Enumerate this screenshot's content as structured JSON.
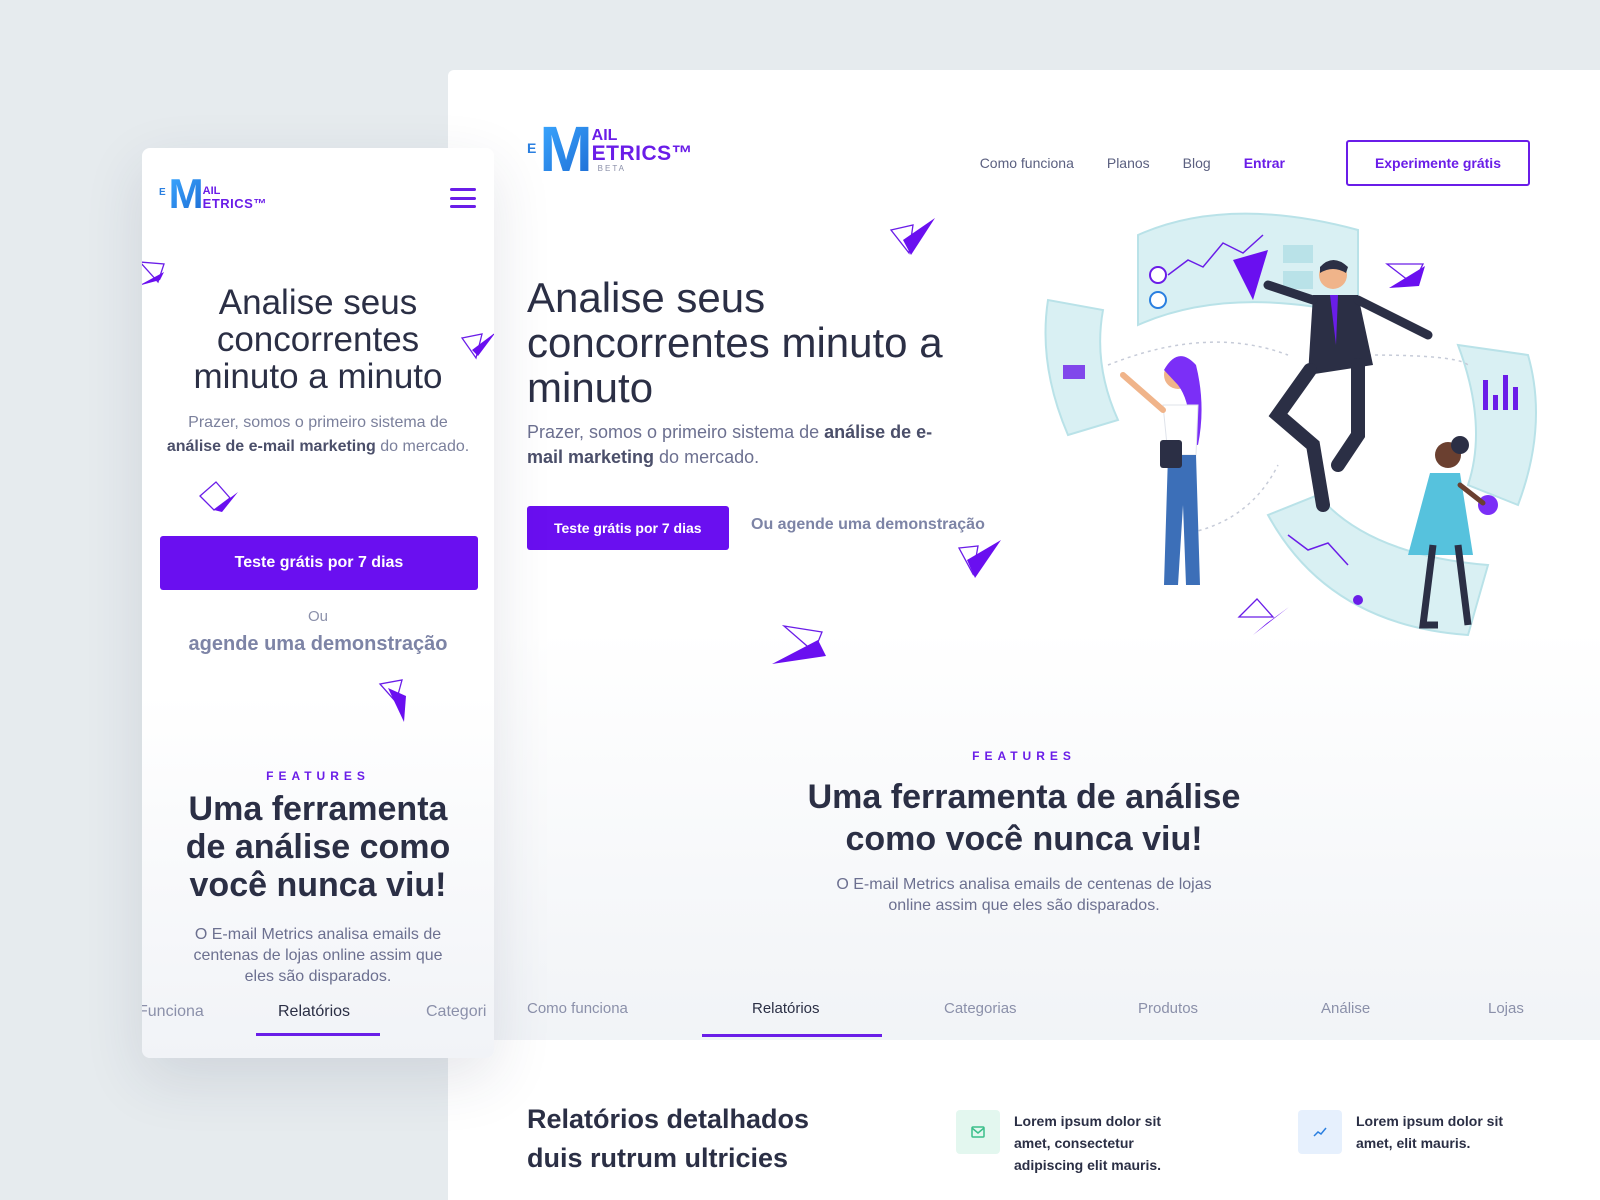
{
  "brand": {
    "logo_e": "E",
    "logo_m": "M",
    "logo_ail": "AIL",
    "logo_etrics": "ETRICS™",
    "logo_beta": "BETA",
    "accent_color": "#6a1de8",
    "logo_color": "#1f8ce8"
  },
  "desktop": {
    "nav": {
      "items": [
        "Como funciona",
        "Planos",
        "Blog"
      ],
      "login": "Entrar",
      "trial_button": "Experimente grátis"
    },
    "hero": {
      "title": "Analise seus concorrentes minuto a minuto",
      "subtitle_pre": "Prazer, somos o primeiro sistema de ",
      "subtitle_bold": "análise de e-mail marketing",
      "subtitle_post": " do mercado.",
      "cta": "Teste grátis por 7 dias",
      "demo_link": "Ou agende uma demonstração"
    },
    "features": {
      "kicker": "FEATURES",
      "title_line1": "Uma ferramenta de análise",
      "title_line2": "como você nunca viu!",
      "sub_line1": "O E-mail Metrics analisa emails de centenas de lojas",
      "sub_line2": "online assim que eles são disparados."
    },
    "tabs": [
      "Como funciona",
      "Relatórios",
      "Categorias",
      "Produtos",
      "Análise",
      "Lojas"
    ],
    "active_tab": "Relatórios",
    "lower": {
      "title_line1": "Relatórios detalhados",
      "title_line2": "duis rutrum ultricies",
      "items": [
        {
          "icon": "mail-icon",
          "text": "Lorem ipsum dolor sit amet, consectetur adipiscing elit mauris."
        },
        {
          "icon": "trend-icon",
          "text": "Lorem ipsum dolor sit amet, elit mauris."
        }
      ]
    }
  },
  "mobile": {
    "hero": {
      "title_line1": "Analise seus",
      "title_line2": "concorrentes",
      "title_line3": "minuto a minuto",
      "subtitle_pre": "Prazer, somos o primeiro sistema de ",
      "subtitle_bold": "análise de e-mail marketing",
      "subtitle_post": " do mercado.",
      "cta": "Teste grátis por 7 dias",
      "or": "Ou",
      "demo_link": "agende uma demonstração"
    },
    "features": {
      "kicker": "FEATURES",
      "title_line1": "Uma ferramenta",
      "title_line2": "de análise como",
      "title_line3": "você nunca viu!",
      "sub_line1": "O E-mail Metrics analisa emails de",
      "sub_line2": "centenas de lojas online assim que",
      "sub_line3": "eles são disparados."
    },
    "tabs": [
      "Funciona",
      "Relatórios",
      "Categori"
    ],
    "active_tab": "Relatórios"
  }
}
